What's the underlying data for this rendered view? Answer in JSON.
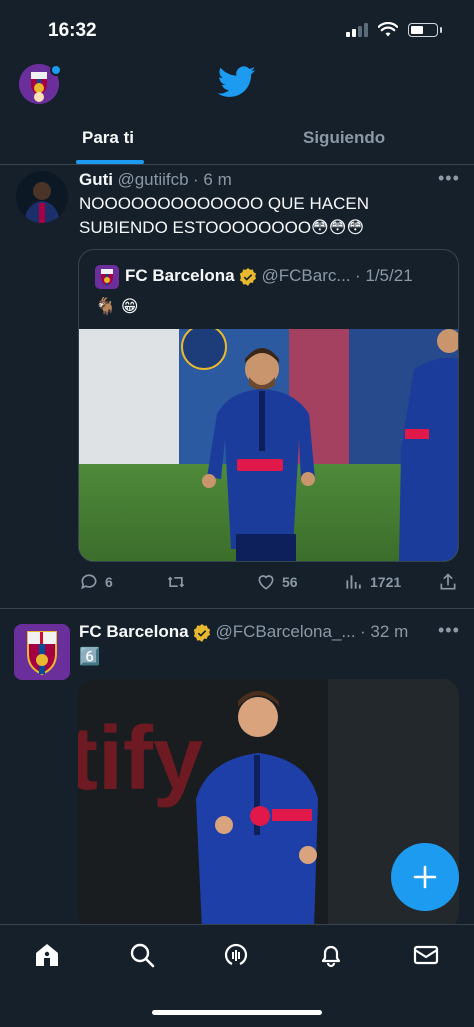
{
  "status": {
    "time": "16:32"
  },
  "header": {
    "logo": "twitter-bird-icon"
  },
  "tabs": [
    {
      "label": "Para ti",
      "active": true
    },
    {
      "label": "Siguiendo",
      "active": false
    }
  ],
  "tweets": [
    {
      "name": "Guti",
      "handle": "@gutiifcb",
      "time": "· 6 m",
      "text_line1": "NOOOOOOOOOOOOO QUE HACEN",
      "text_line2": "SUBIENDO ESTOOOOOOOO😳😳😳",
      "quote": {
        "name": "FC Barcelona",
        "handle": "@FCBarc...",
        "date": "· 1/5/21",
        "text": "🐐 😁"
      },
      "actions": {
        "replies": "6",
        "retweets": "",
        "likes": "56",
        "views": "1721"
      }
    },
    {
      "name": "FC Barcelona",
      "handle": "@FCBarcelona_...",
      "time": "· 32 m",
      "text": "6️⃣"
    }
  ],
  "colors": {
    "accent": "#1d9bf0",
    "background": "#15202b",
    "muted": "#8b98a5",
    "border": "#38444d",
    "verified": "#e8b92e"
  }
}
